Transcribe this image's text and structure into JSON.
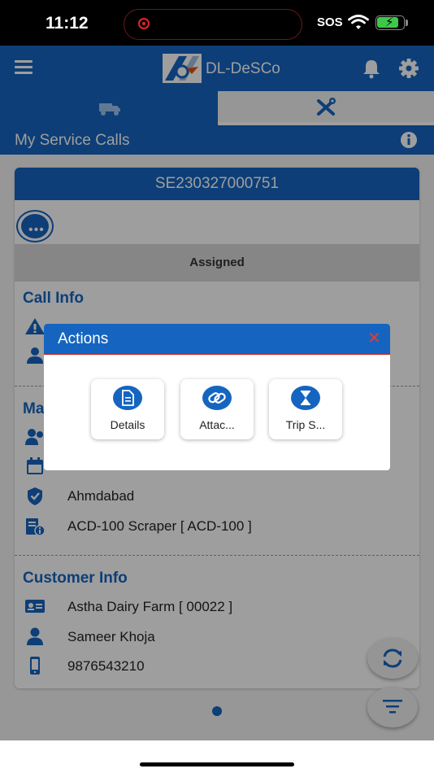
{
  "status_bar": {
    "time": "11:12",
    "sos": "SOS"
  },
  "app_bar": {
    "logo_text": "DL-DeSCo",
    "icons": [
      "menu-icon",
      "company-logo",
      "bell-icon",
      "gear-icon"
    ]
  },
  "tabs": [
    {
      "icon": "truck-icon",
      "selected": true
    },
    {
      "icon": "tools-icon",
      "selected": false
    }
  ],
  "subheader": {
    "title": "My Service Calls",
    "icon": "info-icon"
  },
  "service_call": {
    "id": "SE230327000751",
    "status": "Assigned",
    "call_info": {
      "title": "Call Info"
    },
    "machine_info": {
      "title": "Ma",
      "location": "Ahmdabad",
      "model": "ACD-100 Scraper [ ACD-100 ]"
    },
    "customer_info": {
      "title": "Customer Info",
      "company": "Astha Dairy Farm [ 00022 ]",
      "contact": "Sameer Khoja",
      "phone": "9876543210"
    }
  },
  "modal": {
    "title": "Actions",
    "close_icon": "close-icon",
    "actions": [
      {
        "label": "Details",
        "icon": "document-icon"
      },
      {
        "label": "Attac...",
        "icon": "link-icon"
      },
      {
        "label": "Trip S...",
        "icon": "hourglass-icon"
      }
    ]
  },
  "colors": {
    "primary": "#1565c0",
    "close": "#e53935",
    "battery": "#3ec84a"
  },
  "battery_level": 0.85
}
